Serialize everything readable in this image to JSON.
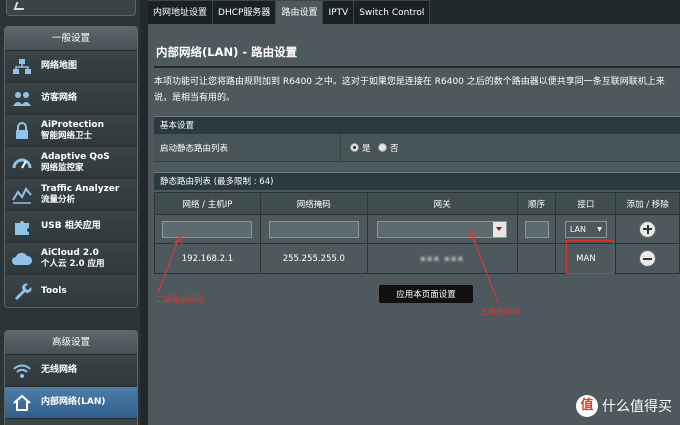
{
  "sidebar": {
    "general_title": "一般设置",
    "general_items": [
      {
        "label": "网络地图",
        "sub": ""
      },
      {
        "label": "访客网络",
        "sub": ""
      },
      {
        "label": "AiProtection",
        "sub": "智能网络卫士"
      },
      {
        "label": "Adaptive QoS",
        "sub": "网络监控家"
      },
      {
        "label": "Traffic Analyzer",
        "sub": "流量分析"
      },
      {
        "label": "USB 相关应用",
        "sub": ""
      },
      {
        "label": "AiCloud 2.0",
        "sub": "个人云 2.0 应用"
      },
      {
        "label": "Tools",
        "sub": ""
      }
    ],
    "advanced_title": "高级设置",
    "advanced_items": [
      {
        "label": "无线网络"
      },
      {
        "label": "内部网络(LAN)"
      }
    ]
  },
  "tabs": [
    "内网地址设置",
    "DHCP服务器",
    "路由设置",
    "IPTV",
    "Switch Control"
  ],
  "page": {
    "title": "内部网络(LAN) - 路由设置",
    "description": "本项功能可让您将路由规则加到 R6400 之中。这对于如果您是连接在 R6400 之后的数个路由器以便共享同一条互联网联机上来说，是相当有用的。"
  },
  "basic": {
    "header": "基本设置",
    "static_route_label": "启动静态路由列表",
    "option_yes": "是",
    "option_no": "否"
  },
  "route_list": {
    "header": "静态路由列表 (最多限制 : 64)",
    "columns": [
      "网络 / 主机IP",
      "网络掩码",
      "网关",
      "顺序",
      "接口",
      "添加 / 移除"
    ],
    "input_row": {
      "interface": "LAN"
    },
    "data_row": {
      "ip": "192.168.2.1",
      "mask": "255.255.255.0",
      "gateway": "▪▪▪ ▪▪▪",
      "interface": "MAN"
    }
  },
  "apply_label": "应用本页面设置",
  "annotations": {
    "left": "二级路由网段",
    "right": "主路由网段"
  },
  "watermark": {
    "logo": "值",
    "text": "什么值得买"
  },
  "colors": {
    "annotation": "#d43a3a",
    "active_menu": "#3f6f9a",
    "content_bg": "#4d595d"
  }
}
